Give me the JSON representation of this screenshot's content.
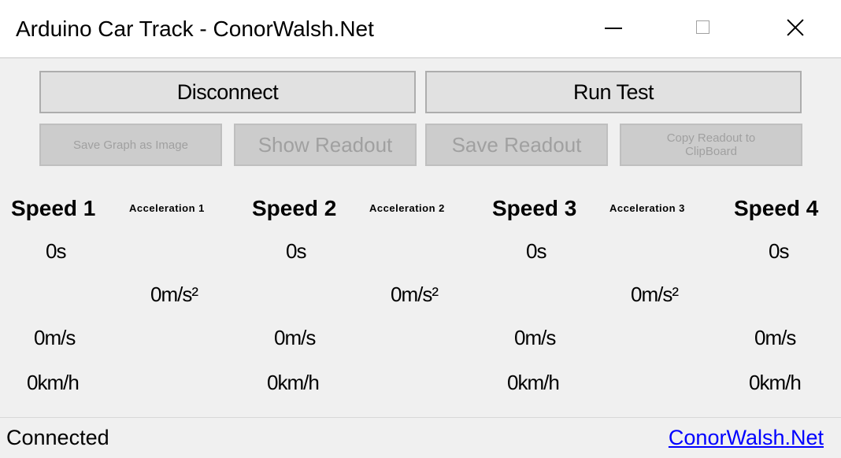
{
  "window": {
    "title": "Arduino Car Track - ConorWalsh.Net"
  },
  "toolbar": {
    "disconnect_label": "Disconnect",
    "run_test_label": "Run Test",
    "save_graph_label": "Save Graph as Image",
    "show_readout_label": "Show Readout",
    "save_readout_label": "Save Readout",
    "copy_readout_label": "Copy Readout to ClipBoard"
  },
  "headers": {
    "speed1": "Speed 1",
    "accel1": "Acceleration 1",
    "speed2": "Speed 2",
    "accel2": "Acceleration 2",
    "speed3": "Speed 3",
    "accel3": "Acceleration 3",
    "speed4": "Speed 4"
  },
  "readings": {
    "speed1": {
      "time": "0s",
      "ms": "0m/s",
      "kmh": "0km/h"
    },
    "speed2": {
      "time": "0s",
      "ms": "0m/s",
      "kmh": "0km/h"
    },
    "speed3": {
      "time": "0s",
      "ms": "0m/s",
      "kmh": "0km/h"
    },
    "speed4": {
      "time": "0s",
      "ms": "0m/s",
      "kmh": "0km/h"
    },
    "accel1": "0m/s²",
    "accel2": "0m/s²",
    "accel3": "0m/s²"
  },
  "status": {
    "connection": "Connected",
    "link": "ConorWalsh.Net"
  },
  "icons": {
    "minimize": "minimize-icon",
    "maximize": "maximize-icon",
    "close": "close-icon"
  }
}
